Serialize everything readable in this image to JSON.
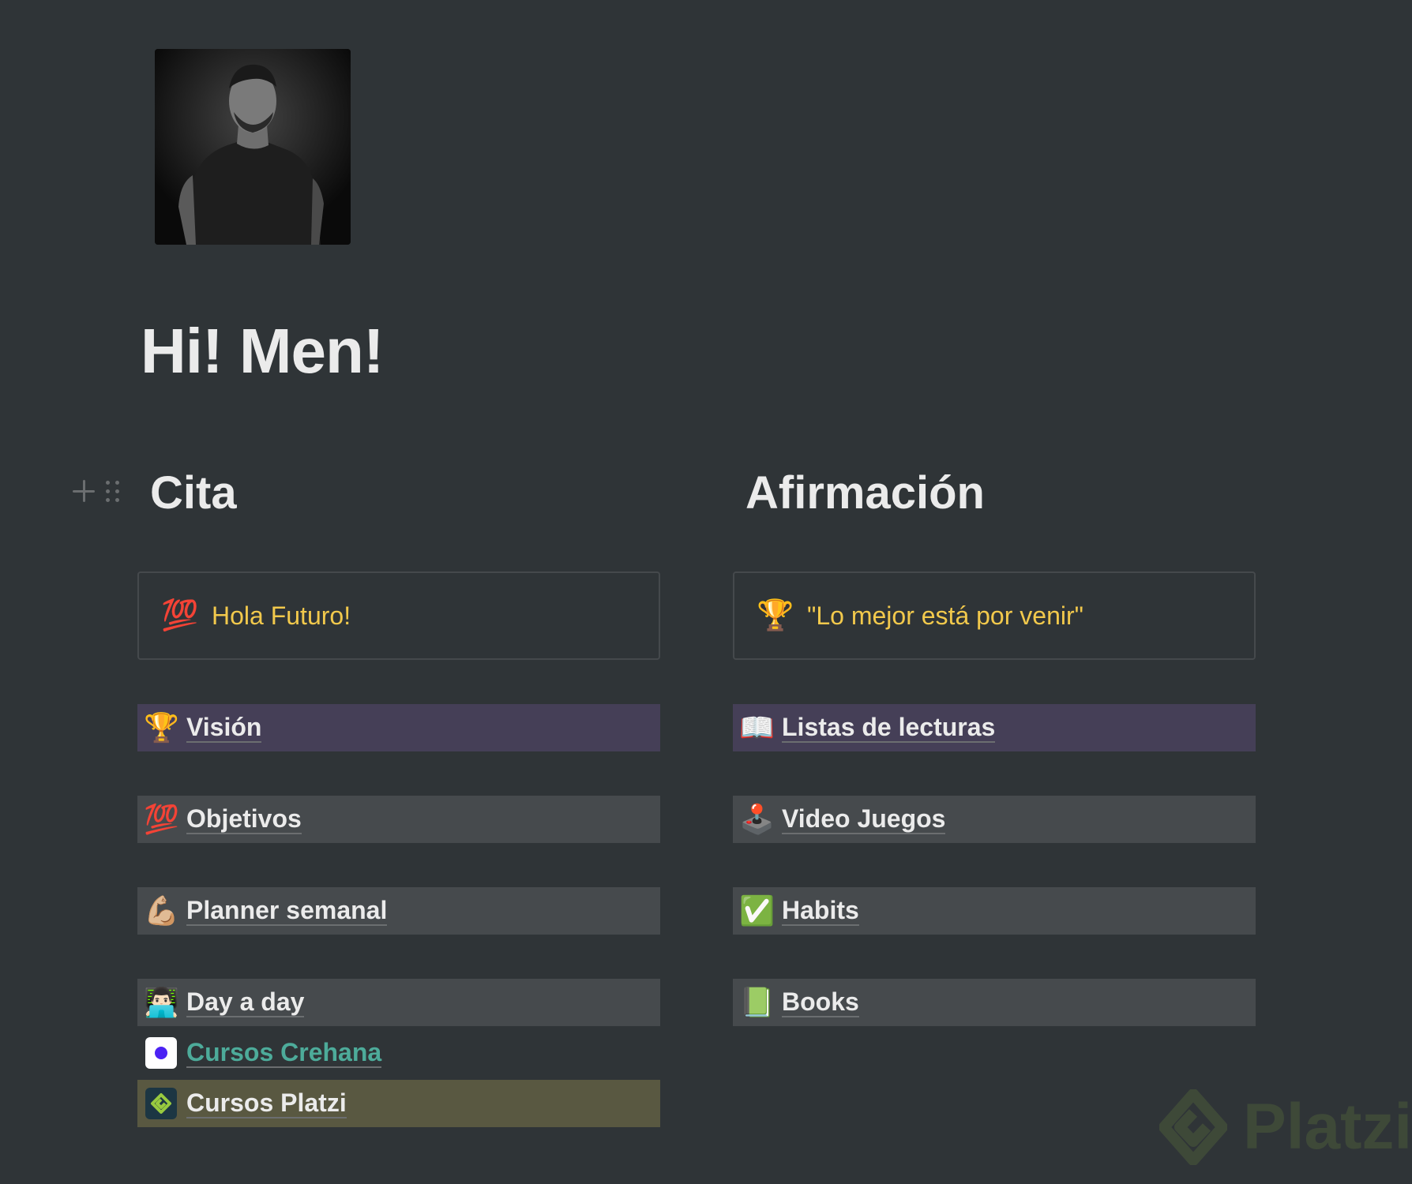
{
  "page": {
    "title": "Hi! Men!",
    "avatar_alt": "profile-photo"
  },
  "left_column": {
    "heading": "Cita",
    "callout": {
      "emoji": "💯",
      "text": "Hola Futuro!"
    },
    "links": [
      {
        "emoji": "🏆",
        "label": "Visión"
      },
      {
        "emoji": "💯",
        "label": "Objetivos"
      },
      {
        "emoji": "💪🏼",
        "label": "Planner semanal"
      },
      {
        "emoji": "👨🏻‍💻",
        "label": "Day a day"
      },
      {
        "icon": "crehana-icon",
        "label": "Cursos Crehana"
      },
      {
        "icon": "platzi-icon",
        "label": "Cursos Platzi"
      }
    ]
  },
  "right_column": {
    "heading": "Afirmación",
    "callout": {
      "emoji": "🏆",
      "text": "\"Lo mejor está por venir\""
    },
    "links": [
      {
        "emoji": "📖",
        "label": "Listas de lecturas"
      },
      {
        "emoji": "🕹️",
        "label": "Video Juegos"
      },
      {
        "emoji": "✅",
        "label": "Habits"
      },
      {
        "emoji": "📗",
        "label": "Books"
      }
    ]
  },
  "watermark": {
    "text": "Platzi"
  },
  "colors": {
    "background": "#2f3437",
    "callout_text": "#f2c94c",
    "purple_block": "#453f57",
    "gray_block": "#464a4d",
    "olive_block": "#595841",
    "teal_link": "#4dab9a"
  }
}
